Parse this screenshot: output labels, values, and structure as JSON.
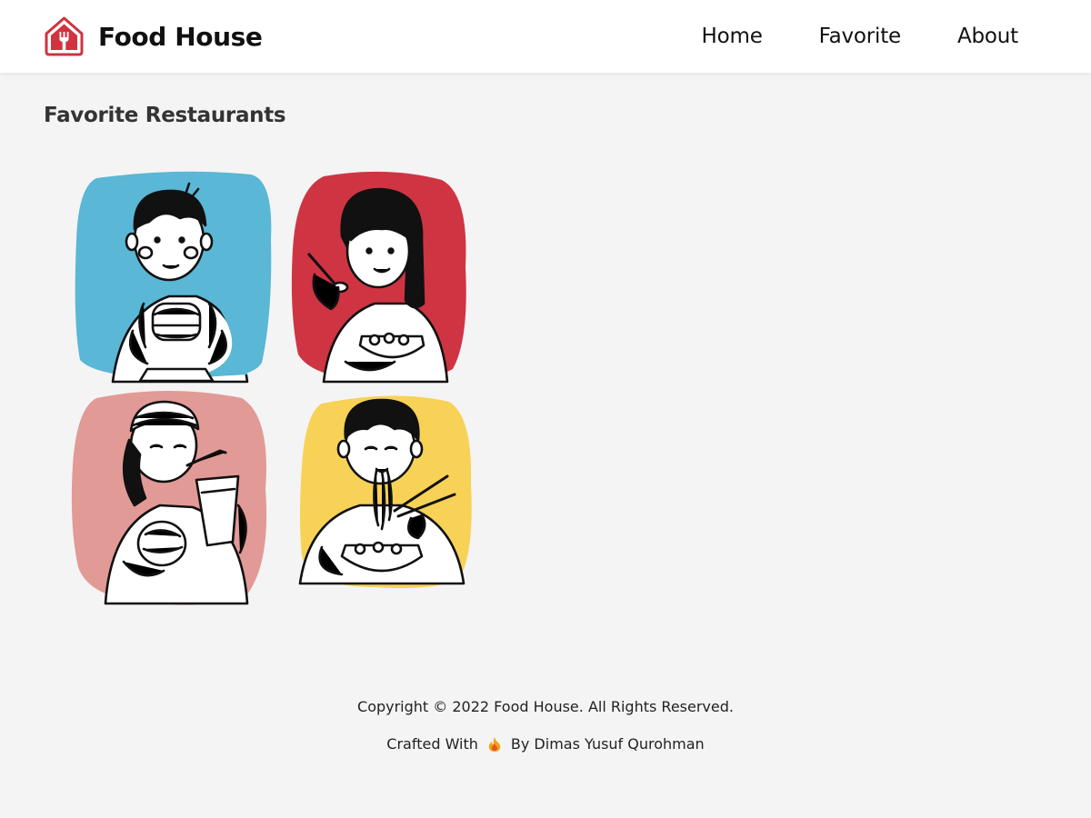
{
  "header": {
    "brand_name": "Food House",
    "logo_icon": "house-fork-logo-icon",
    "nav": [
      {
        "label": "Home"
      },
      {
        "label": "Favorite"
      },
      {
        "label": "About"
      }
    ]
  },
  "main": {
    "title": "Favorite Restaurants",
    "illustration_icons": [
      "eating-burger-illustration",
      "eating-with-spoon-illustration",
      "drinking-soda-illustration",
      "eating-noodles-illustration"
    ]
  },
  "footer": {
    "copyright": "Copyright © 2022 Food House. All Rights Reserved.",
    "crafted_prefix": "Crafted With",
    "flame_icon": "flame-icon",
    "crafted_suffix": "By Dimas Yusuf Qurohman"
  },
  "colors": {
    "accent": "#d1333f",
    "tile_blue": "#5ab7d6",
    "tile_red": "#cf3443",
    "tile_pink": "#e29a96",
    "tile_yellow": "#f7d257",
    "background": "#f4f4f4"
  }
}
